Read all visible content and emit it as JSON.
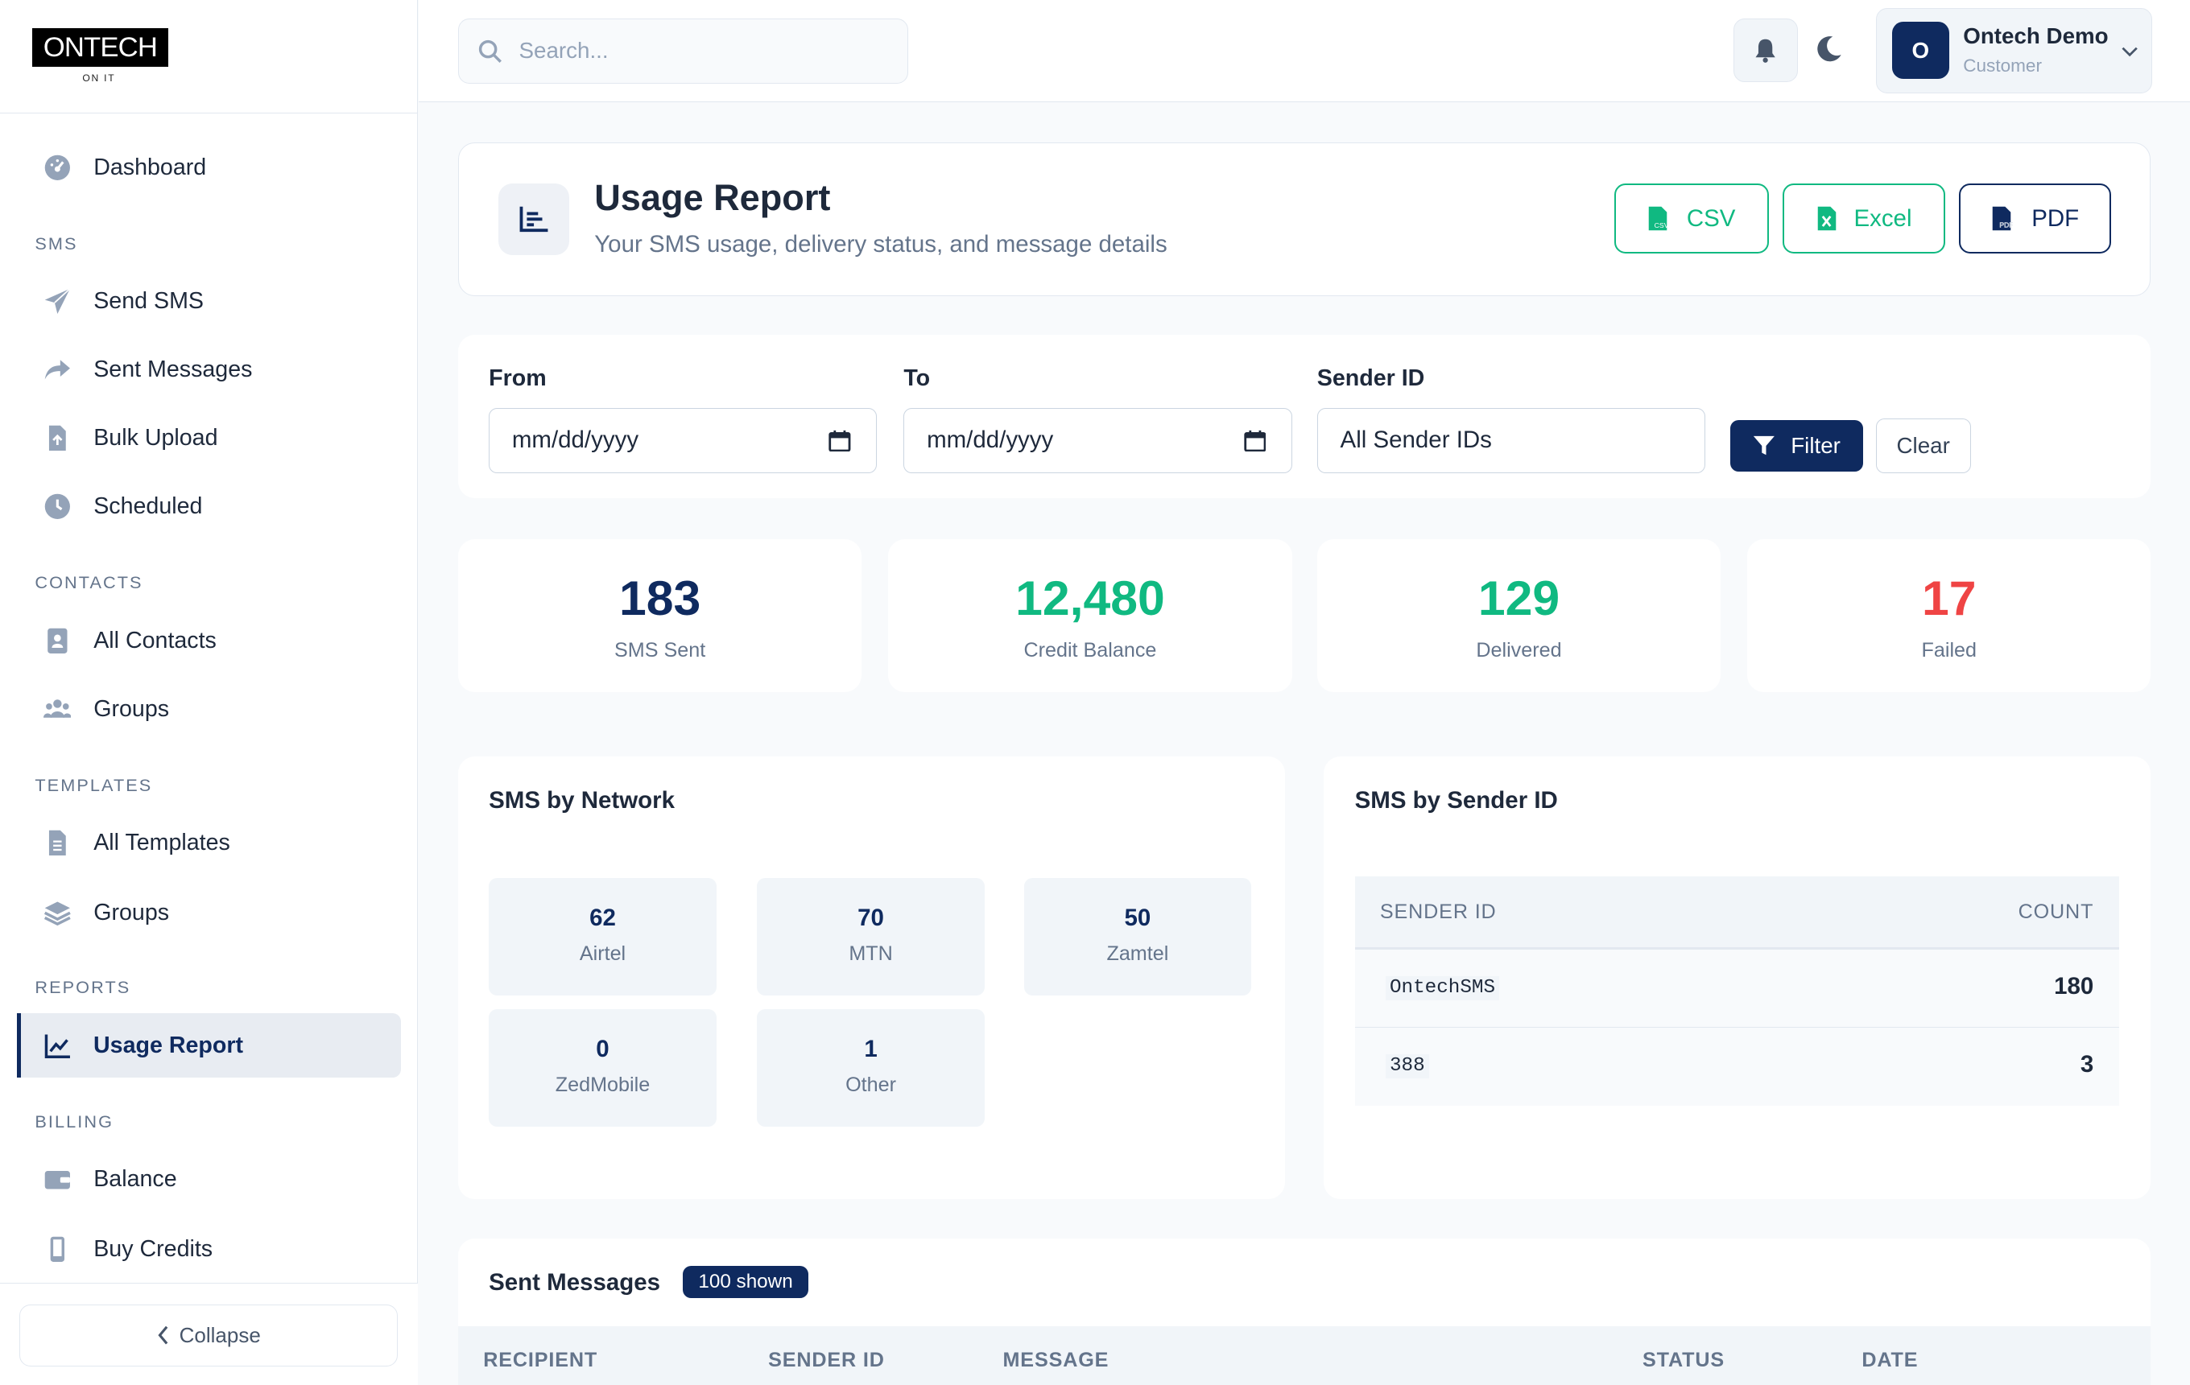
{
  "brand": {
    "logo_text": "ONTECH",
    "tagline": "ON IT"
  },
  "sidebar": {
    "dashboard": "Dashboard",
    "sections": {
      "sms": "SMS",
      "contacts": "CONTACTS",
      "templates": "TEMPLATES",
      "reports": "REPORTS",
      "billing": "BILLING"
    },
    "items": {
      "send_sms": "Send SMS",
      "sent_messages": "Sent Messages",
      "bulk_upload": "Bulk Upload",
      "scheduled": "Scheduled",
      "all_contacts": "All Contacts",
      "contact_groups": "Groups",
      "all_templates": "All Templates",
      "template_groups": "Groups",
      "usage_report": "Usage Report",
      "balance": "Balance",
      "buy_credits": "Buy Credits"
    },
    "collapse_label": "Collapse"
  },
  "topbar": {
    "search_placeholder": "Search...",
    "user": {
      "initial": "O",
      "name": "Ontech Demo",
      "role": "Customer"
    }
  },
  "page": {
    "title": "Usage Report",
    "subtitle": "Your SMS usage, delivery status, and message details",
    "exports": {
      "csv": "CSV",
      "excel": "Excel",
      "pdf": "PDF"
    }
  },
  "filters": {
    "from_label": "From",
    "from_value": "mm/dd/yyyy",
    "to_label": "To",
    "to_value": "mm/dd/yyyy",
    "sender_label": "Sender ID",
    "sender_value": "All Sender IDs",
    "filter_button": "Filter",
    "clear_button": "Clear"
  },
  "stats": [
    {
      "value": "183",
      "label": "SMS Sent",
      "color": "#0f2a5f"
    },
    {
      "value": "12,480",
      "label": "Credit Balance",
      "color": "#10b981"
    },
    {
      "value": "129",
      "label": "Delivered",
      "color": "#10b981"
    },
    {
      "value": "17",
      "label": "Failed",
      "color": "#ef4444"
    }
  ],
  "by_network": {
    "title": "SMS by Network",
    "items": [
      {
        "value": "62",
        "label": "Airtel"
      },
      {
        "value": "70",
        "label": "MTN"
      },
      {
        "value": "50",
        "label": "Zamtel"
      },
      {
        "value": "0",
        "label": "ZedMobile"
      },
      {
        "value": "1",
        "label": "Other"
      }
    ]
  },
  "by_sender": {
    "title": "SMS by Sender ID",
    "columns": {
      "sender": "SENDER ID",
      "count": "COUNT"
    },
    "rows": [
      {
        "sender": "OntechSMS",
        "count": "180"
      },
      {
        "sender": "388",
        "count": "3"
      }
    ]
  },
  "sent_messages": {
    "title": "Sent Messages",
    "badge": "100 shown",
    "columns": {
      "recipient": "RECIPIENT",
      "sender": "SENDER ID",
      "message": "MESSAGE",
      "status": "STATUS",
      "date": "DATE"
    }
  },
  "colors": {
    "primary": "#0f2a5f",
    "success": "#10b981",
    "danger": "#ef4444",
    "muted": "#64748b"
  }
}
